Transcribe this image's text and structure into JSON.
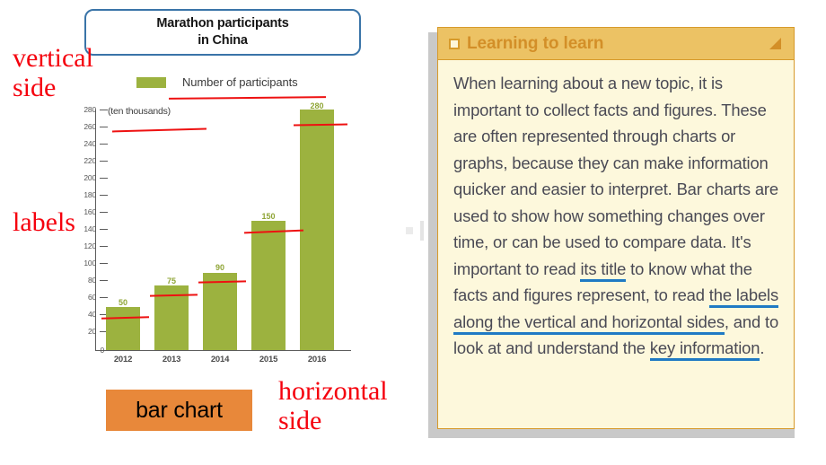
{
  "chart_data": {
    "type": "bar",
    "title": "Marathon participants in China",
    "title_lines": [
      "Marathon participants",
      "in China"
    ],
    "units_note": "(ten thousands)",
    "legend": [
      {
        "name": "Number of participants",
        "color": "#9cb23f"
      }
    ],
    "legend_position": "top",
    "categories": [
      "2012",
      "2013",
      "2014",
      "2015",
      "2016"
    ],
    "values": [
      50,
      75,
      90,
      150,
      280
    ],
    "series": [
      {
        "name": "Number of participants",
        "values": [
          50,
          75,
          90,
          150,
          280
        ]
      }
    ],
    "xlabel": "",
    "ylabel": "(ten thousands)",
    "ylim": [
      0,
      280
    ],
    "ytick_step": 20,
    "yticks": [
      280,
      260,
      240,
      220,
      200,
      180,
      160,
      140,
      120,
      100,
      80,
      60,
      40,
      20,
      0
    ],
    "grid": false,
    "bar_color": "#9cb23f",
    "value_label_color": "#8fa536"
  },
  "annotations": {
    "color": "#f5000d",
    "vertical_side": "vertical\nside",
    "vertical_side_lines": [
      "vertical",
      "side"
    ],
    "labels": "labels",
    "horizontal_side_lines": [
      "horizontal",
      "side"
    ],
    "bar_chart_tag": "bar chart",
    "bar_chart_tag_bg": "#e8883a",
    "underline_color": "#ee1111"
  },
  "title_box": {
    "border_color": "#3a74a8"
  },
  "learn_panel": {
    "header_title": "Learning to learn",
    "header_bg": "#ecc264",
    "header_text_color": "#d38f28",
    "body_bg": "#fdf8dc",
    "border_color": "#d79a2b",
    "underline_color": "#1f7ac4",
    "icons": {
      "left": "square-icon",
      "right": "triangle-icon"
    },
    "body_segments": [
      {
        "text": "When learning about a new topic, it is important to collect facts and figures. These are often represented through charts or graphs, because they can make information quicker and easier to interpret. Bar charts are used to show how something changes over time, or can be used to compare data. It's important to read ",
        "underline": false
      },
      {
        "text": "its title",
        "underline": true
      },
      {
        "text": " to know what the facts and figures represent, to read ",
        "underline": false
      },
      {
        "text": "the labels along the vertical and horizontal sides",
        "underline": true
      },
      {
        "text": ", and to look at and understand the ",
        "underline": false
      },
      {
        "text": "key information",
        "underline": true
      },
      {
        "text": ".",
        "underline": false
      }
    ],
    "body_text_plain": "When learning about a new topic, it is important to collect facts and figures. These are often represented through charts or graphs, because they can make information quicker and easier to interpret. Bar charts are used to show how something changes over time, or can be used to compare data. It's important to read its title to know what the facts and figures represent, to read the labels along the vertical and horizontal sides, and to look at and understand the key information."
  }
}
